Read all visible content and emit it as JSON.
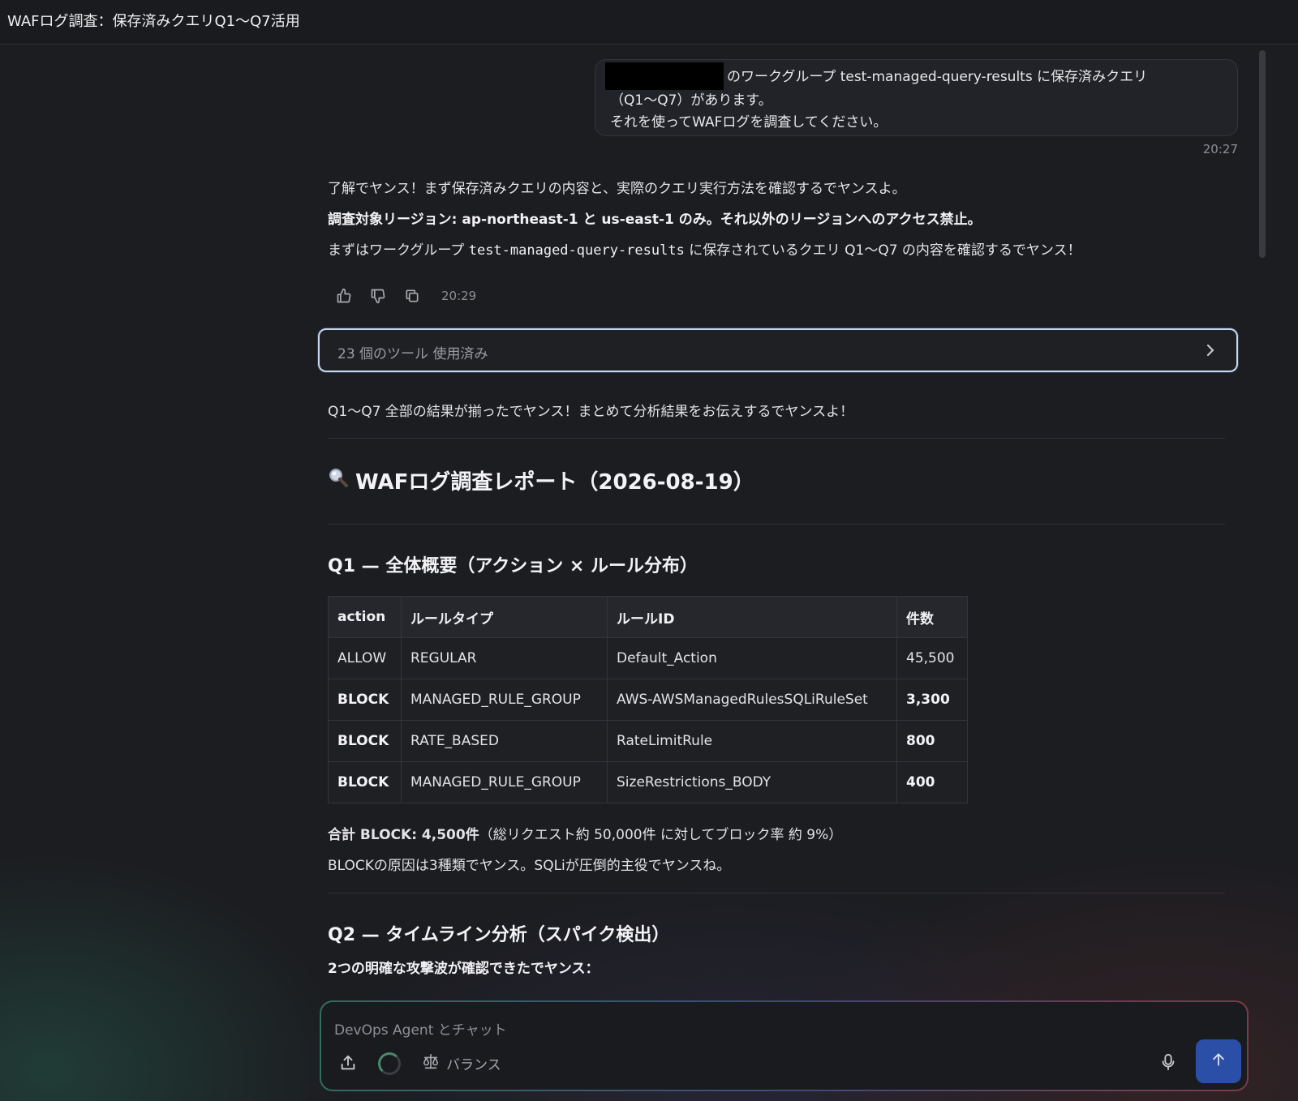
{
  "window": {
    "title": "WAFログ調査：保存済みクエリQ1〜Q7活用"
  },
  "user_message": {
    "line1": "のワークグループ test-managed-query-results に保存済みクエリ",
    "line2": "（Q1〜Q7）があります。",
    "line3": "それを使ってWAFログを調査してください。",
    "time": "20:27"
  },
  "assistant_intro": {
    "line1": "了解でヤンス！まず保存済みクエリの内容と、実際のクエリ実行方法を確認するでヤンスよ。",
    "line2": "調査対象リージョン: ap-northeast-1 と us-east-1 のみ。それ以外のリージョンへのアクセス禁止。",
    "line3_pre": "まずはワークグループ ",
    "line3_code": "test-managed-query-results",
    "line3_post": " に保存されているクエリ Q1〜Q7 の内容を確認するでヤンス！",
    "time": "20:29"
  },
  "feedback_icons": [
    "thumbs-up-icon",
    "thumbs-down-icon",
    "copy-icon"
  ],
  "tools_used": {
    "label": "23 個のツール 使用済み"
  },
  "summary_line": "Q1〜Q7 全部の結果が揃ったでヤンス！まとめて分析結果をお伝えするでヤンスよ！",
  "report": {
    "title_icon": "magnifier-icon",
    "title": "WAFログ調査レポート（2026-08-19）",
    "q1_heading": "Q1 — 全体概要（アクション × ルール分布）",
    "q1_table": {
      "headers": [
        "action",
        "ルールタイプ",
        "ルールID",
        "件数"
      ],
      "rows": [
        [
          "ALLOW",
          "REGULAR",
          "Default_Action",
          "45,500"
        ],
        [
          "BLOCK",
          "MANAGED_RULE_GROUP",
          "AWS-AWSManagedRulesSQLiRuleSet",
          "3,300"
        ],
        [
          "BLOCK",
          "RATE_BASED",
          "RateLimitRule",
          "800"
        ],
        [
          "BLOCK",
          "MANAGED_RULE_GROUP",
          "SizeRestrictions_BODY",
          "400"
        ]
      ]
    },
    "q1_total_bold": "合計 BLOCK: 4,500件",
    "q1_total_rest": "（総リクエスト約 50,000件 に対してブロック率 約 9%）",
    "q1_note": "BLOCKの原因は3種類でヤンス。SQLiが圧倒的主役でヤンスね。",
    "q2_heading": "Q2 — タイムライン分析（スパイク検出）",
    "q2_intro": "2つの明確な攻撃波が確認できたでヤンス："
  },
  "composer": {
    "placeholder": "DevOps Agent とチャット",
    "mode_label": "バランス",
    "mode_icon": "scale-icon"
  }
}
